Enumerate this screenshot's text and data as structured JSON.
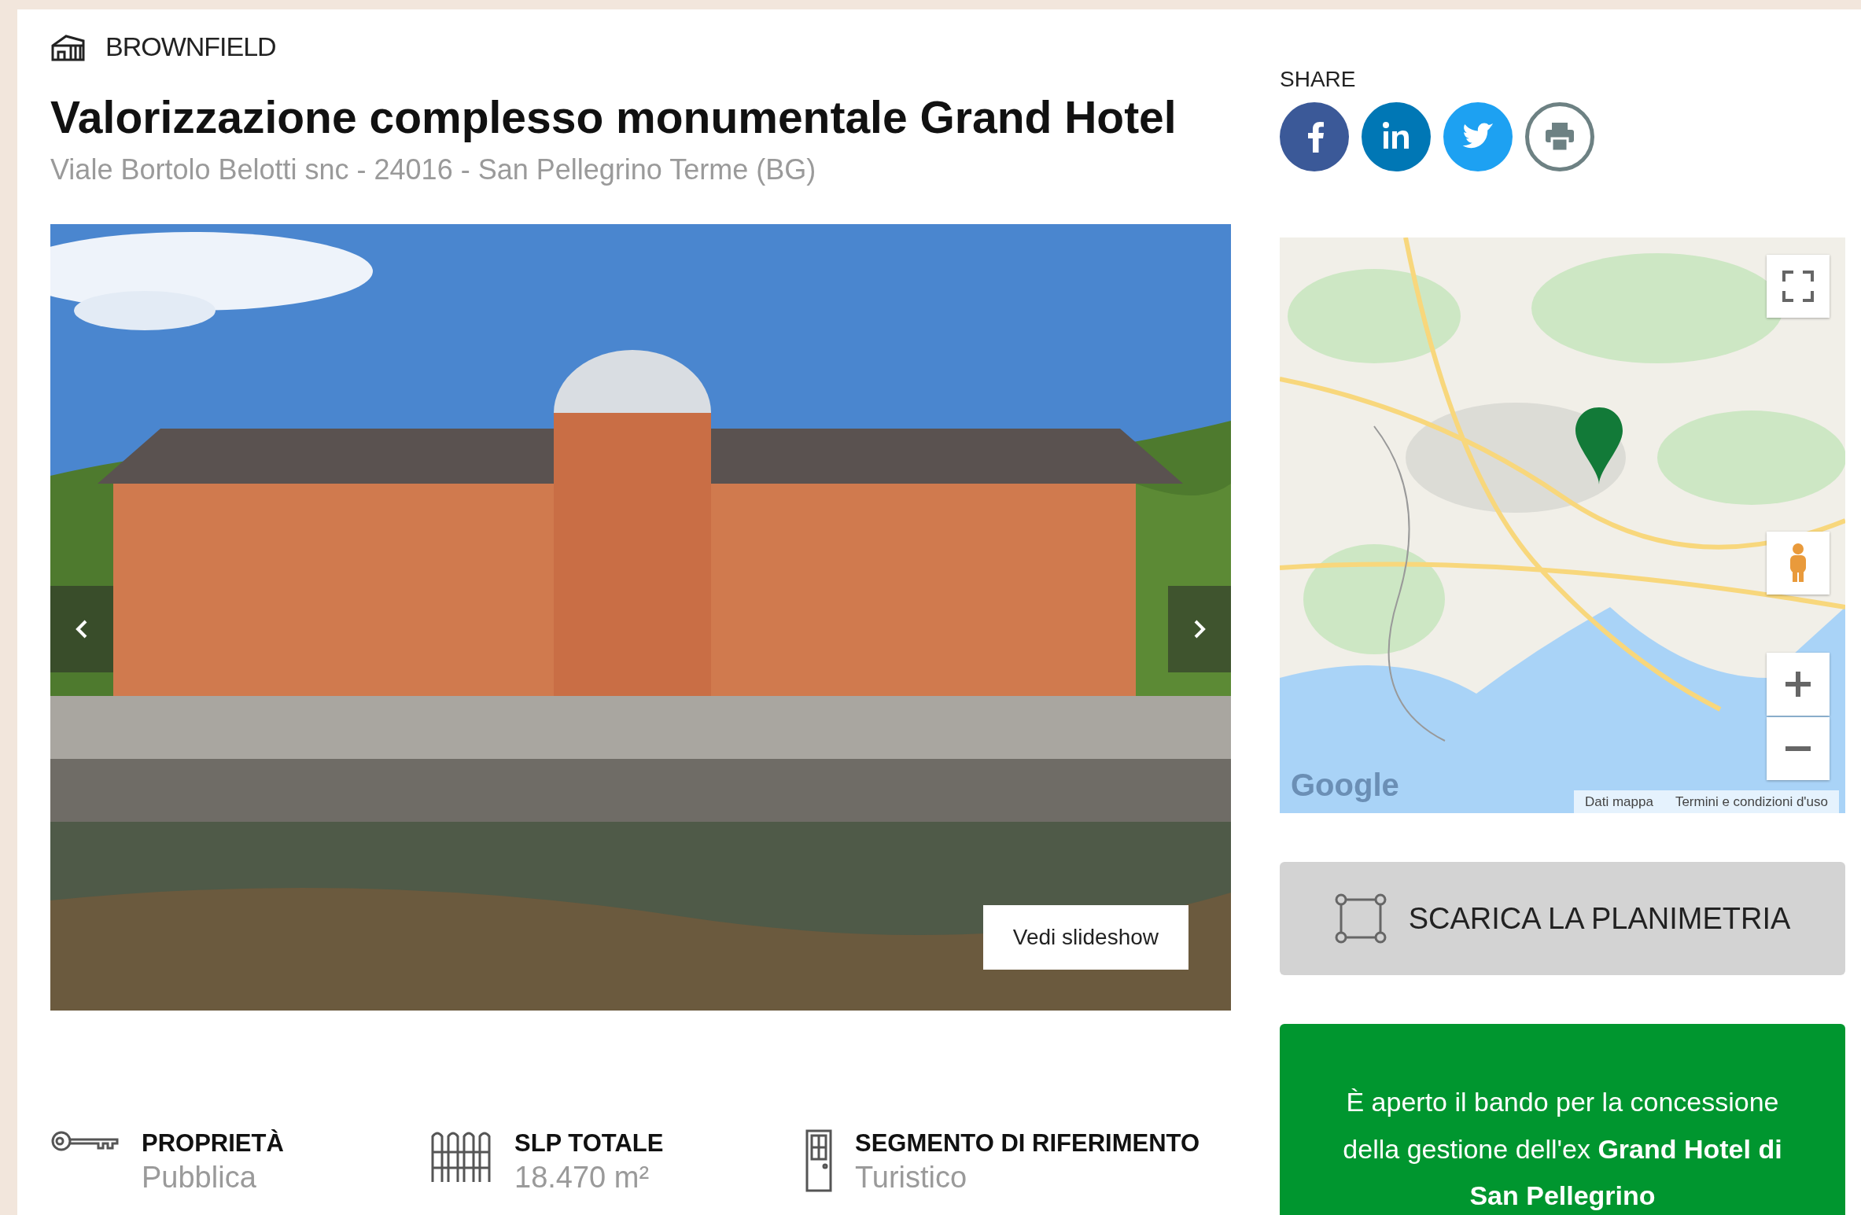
{
  "category": {
    "label": "BROWNFIELD"
  },
  "title": "Valorizzazione complesso monumentale Grand Hotel",
  "address": "Viale Bortolo Belotti snc - 24016 - San Pellegrino Terme (BG)",
  "gallery": {
    "kind": "picture",
    "button": "Vedi slideshow"
  },
  "facts": [
    {
      "kind": "ownership",
      "label": "PROPRIETÀ",
      "value": "Pubblica"
    },
    {
      "kind": "area",
      "label": "SLP TOTALE",
      "value": "18.470 m²"
    },
    {
      "kind": "segment",
      "label": "SEGMENTO DI RIFERIMENTO",
      "value": "Turistico"
    }
  ],
  "share": {
    "label": "SHARE",
    "buttons": [
      {
        "kind": "facebook"
      },
      {
        "kind": "linkedin"
      },
      {
        "kind": "twitter"
      },
      {
        "kind": "print"
      }
    ]
  },
  "map": {
    "logo": "Google",
    "attribution": [
      "Dati mappa",
      "Termini e condizioni d'uso"
    ]
  },
  "download_button": {
    "label": "SCARICA LA PLANIMETRIA"
  },
  "notice": {
    "text": "È aperto il bando per la concessione della gestione dell'ex **Grand Hotel di San Pellegrino**"
  }
}
